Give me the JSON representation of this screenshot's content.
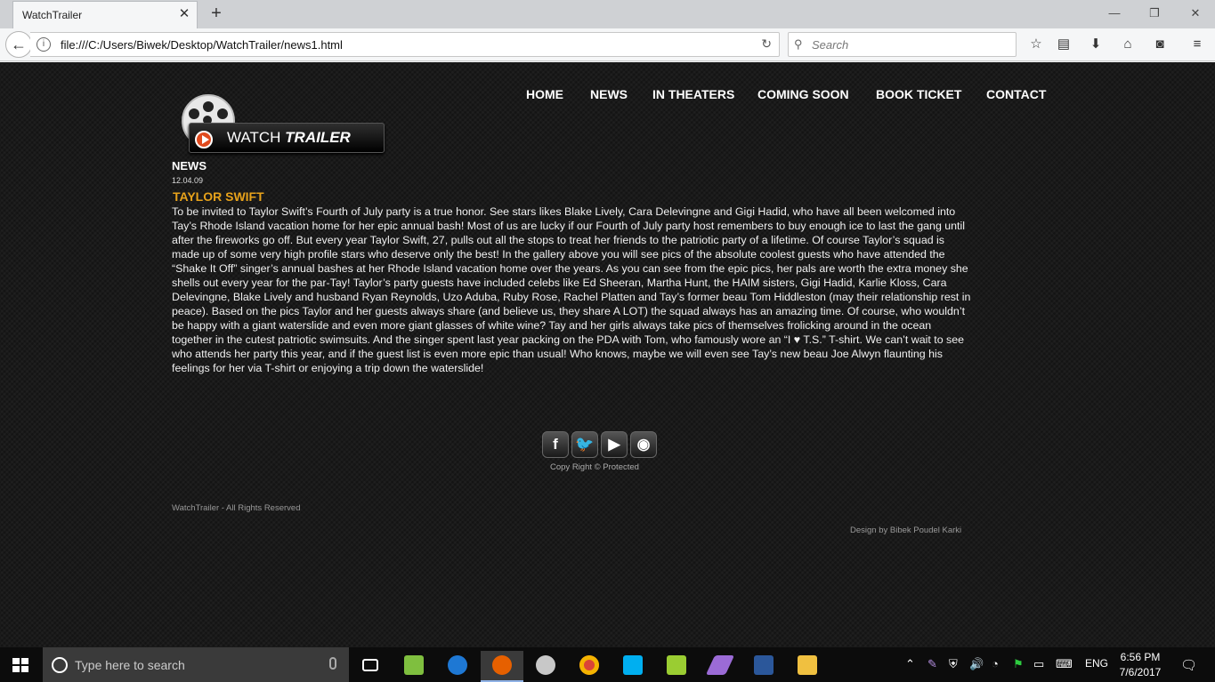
{
  "browser": {
    "tab_title": "WatchTrailer",
    "url": "file:///C:/Users/Biwek/Desktop/WatchTrailer/news1.html",
    "search_placeholder": "Search"
  },
  "site": {
    "logo_text_plain": "WATCH",
    "logo_text_bold": "TRAILER",
    "menu": [
      "HOME",
      "NEWS",
      "IN THEATERS",
      "COMING SOON",
      "BOOK TICKET",
      "CONTACT"
    ],
    "section_title": "NEWS",
    "date": "12.04.09",
    "headline": "TAYLOR SWIFT",
    "body": "To be invited to Taylor Swift’s Fourth of July party is a true honor. See stars likes Blake Lively, Cara Delevingne and Gigi Hadid, who have all been welcomed into Tay’s Rhode Island vacation home for her epic annual bash! Most of us are lucky if our Fourth of July party host remembers to buy enough ice to last the gang until after the fireworks go off. But every year Taylor Swift, 27, pulls out all the stops to treat her friends to the patriotic party of a lifetime. Of course Taylor’s squad is made up of some very high profile stars who deserve only the best! In the gallery above you will see pics of the absolute coolest guests who have attended the “Shake It Off” singer’s annual bashes at her Rhode Island vacation home over the years. As you can see from the epic pics, her pals are worth the extra money she shells out every year for the par-Tay! Taylor’s party guests have included celebs like Ed Sheeran, Martha Hunt, the HAIM sisters, Gigi Hadid, Karlie Kloss, Cara Delevingne, Blake Lively and husband Ryan Reynolds, Uzo Aduba, Ruby Rose, Rachel Platten and Tay’s former beau Tom Hiddleston (may their relationship rest in peace). Based on the pics Taylor and her guests always share (and believe us, they share A LOT) the squad always has an amazing time. Of course, who wouldn’t be happy with a giant waterslide and even more giant glasses of white wine? Tay and her girls always take pics of themselves frolicking around in the ocean together in the cutest patriotic swimsuits. And the singer spent last year packing on the PDA with Tom, who famously wore an “I ♥ T.S.” T-shirt. We can’t wait to see who attends her party this year, and if the guest list is even more epic than usual! Who knows, maybe we will even see Tay’s new beau Joe Alwyn flaunting his feelings for her via T-shirt or enjoying a trip down the waterslide!",
    "copyright": "Copy Right © Protected",
    "reserved": "WatchTrailer - All Rights Reserved",
    "design": "Design by Bibek Poudel Karki"
  },
  "taskbar": {
    "search_placeholder": "Type here to search",
    "language": "ENG",
    "time": "6:56 PM",
    "date": "7/6/2017"
  },
  "colors": {
    "accent_headline": "#e7a21b",
    "page_bg": "#1b1b1b"
  }
}
